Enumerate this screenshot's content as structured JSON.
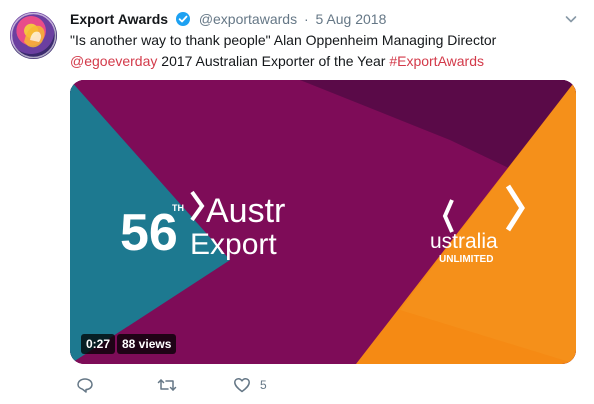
{
  "tweet": {
    "author_name": "Export Awards",
    "handle": "@exportawards",
    "separator": "·",
    "date": "5 Aug 2018",
    "text_line1": "\"Is another way to thank people\" Alan Oppenheim Managing Director",
    "mention": "@egoeverday",
    "text_middle": " 2017 Australian Exporter of the Year ",
    "hashtag": "#ExportAwards",
    "accent_color": "#d33a4a",
    "verified_color": "#1da1f2"
  },
  "video": {
    "duration": "0:27",
    "views": "88 views",
    "title_number": "56",
    "title_suffix": "TH",
    "title_word1": "Austr",
    "title_word2": "Export",
    "brand_word": "ustralia",
    "brand_sub": "UNLIMITED",
    "colors": {
      "teal": "#1f7e95",
      "magenta": "#8a0e5e",
      "plum": "#5c0a4a",
      "orange": "#f58a14"
    }
  },
  "actions": {
    "reply_icon": "reply-icon",
    "retweet_icon": "retweet-icon",
    "like_icon": "heart-icon",
    "like_count": "5"
  }
}
